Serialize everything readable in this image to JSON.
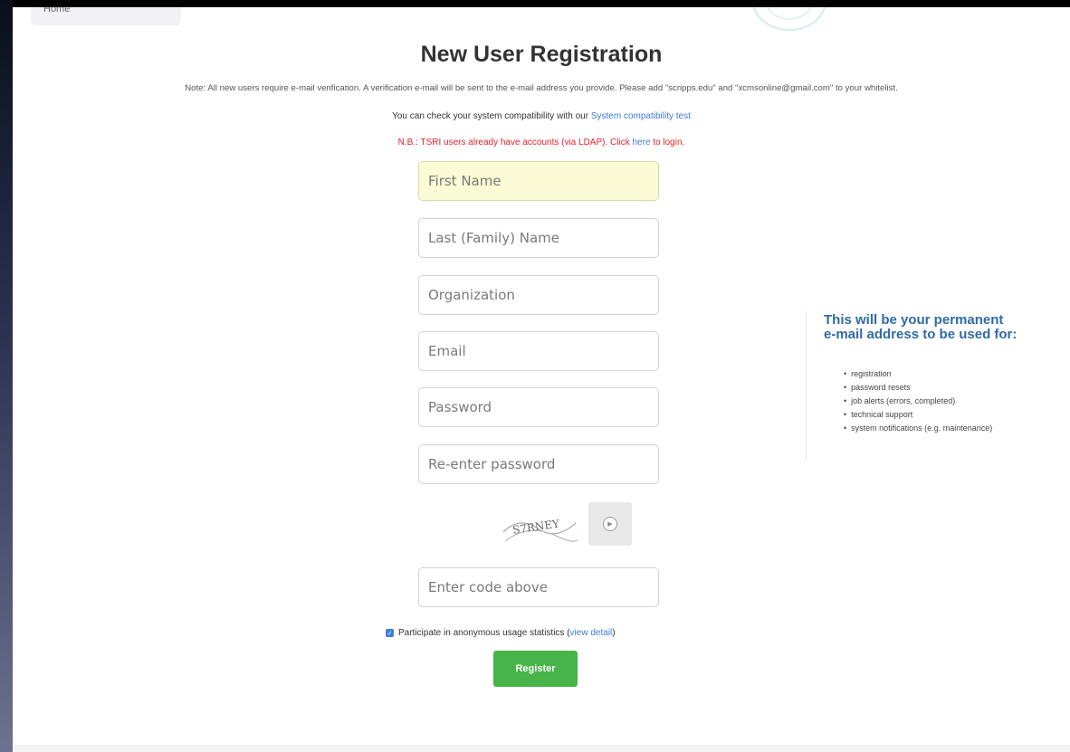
{
  "top_tab": {
    "label": "Home"
  },
  "title": "New User Registration",
  "note": "Note: All new users require e-mail verification. A verification e-mail will be sent to the e-mail address you provide. Please add \"scripps.edu\" and \"xcmsonline@gmail.com\" to your whitelist.",
  "compat": {
    "text": "You can check your system compatibility with our ",
    "link": "System compatibility test"
  },
  "tsri": {
    "text_before": "N.B.: TSRI users already have accounts (via LDAP). Click ",
    "link": "here",
    "text_after": " to login."
  },
  "form": {
    "first_name": {
      "placeholder": "First Name",
      "value": ""
    },
    "last_name": {
      "placeholder": "Last (Family) Name",
      "value": ""
    },
    "organization": {
      "placeholder": "Organization",
      "value": ""
    },
    "email": {
      "placeholder": "Email",
      "value": ""
    },
    "password": {
      "placeholder": "Password",
      "value": ""
    },
    "password_confirm": {
      "placeholder": "Re-enter password",
      "value": ""
    },
    "captcha_text": "S7RNEY",
    "captcha_code": {
      "placeholder": "Enter code above",
      "value": ""
    },
    "usage_checkbox_checked": true,
    "usage_label": "Participate in anonymous usage statistics (",
    "usage_link": "view detail",
    "usage_close": ")",
    "register_label": "Register"
  },
  "sidebar": {
    "title_line1": "This will be your permanent",
    "title_line2": "e-mail address to be used for:",
    "items": [
      "registration",
      "password resets",
      "job alerts (errors, completed)",
      "technical support",
      "system notifications (e.g. maintenance)"
    ]
  },
  "colors": {
    "title": "#333333",
    "alert": "#e8222a",
    "link": "#3d7bd9",
    "sidebar_title": "#2f6aa6",
    "register_button": "#47b449",
    "active_field": "#fbfbd6"
  }
}
